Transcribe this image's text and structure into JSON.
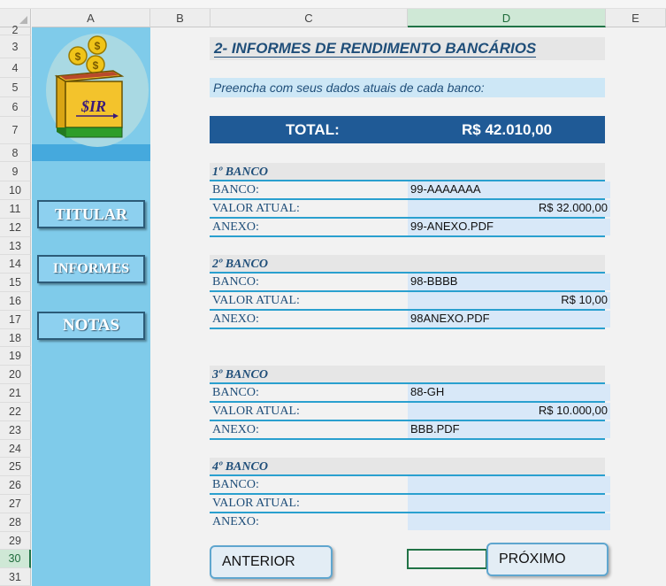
{
  "columns": [
    "A",
    "B",
    "C",
    "D",
    "E"
  ],
  "selected_column": "D",
  "rows": [
    "2",
    "3",
    "4",
    "5",
    "6",
    "7",
    "8",
    "9",
    "10",
    "11",
    "12",
    "13",
    "14",
    "15",
    "16",
    "17",
    "18",
    "19",
    "20",
    "21",
    "22",
    "23",
    "24",
    "25",
    "26",
    "27",
    "28",
    "29",
    "30",
    "31"
  ],
  "selected_row": "30",
  "logo": {
    "label": "$IR"
  },
  "sidebar": {
    "buttons": [
      "TITULAR",
      "INFORMES",
      "NOTAS"
    ]
  },
  "form": {
    "title": "2-  INFORMES DE RENDIMENTO BANCÁRIOS",
    "subtitle": "Preencha com seus dados atuais de cada banco:",
    "total_label": "TOTAL:",
    "total_value": "R$ 42.010,00",
    "banks": [
      {
        "heading": "1º BANCO",
        "banco_label": "BANCO:",
        "banco": "99-AAAAAAA",
        "valor_label": "VALOR ATUAL:",
        "valor": "R$ 32.000,00",
        "anexo_label": "ANEXO:",
        "anexo": "99-ANEXO.PDF"
      },
      {
        "heading": "2º BANCO",
        "banco_label": "BANCO:",
        "banco": "98-BBBB",
        "valor_label": "VALOR ATUAL:",
        "valor": "R$ 10,00",
        "anexo_label": "ANEXO:",
        "anexo": "98ANEXO.PDF"
      },
      {
        "heading": "3º BANCO",
        "banco_label": "BANCO:",
        "banco": "88-GH",
        "valor_label": "VALOR ATUAL:",
        "valor": "R$ 10.000,00",
        "anexo_label": "ANEXO:",
        "anexo": "BBB.PDF"
      },
      {
        "heading": "4º BANCO",
        "banco_label": "BANCO:",
        "banco": "",
        "valor_label": "VALOR ATUAL:",
        "valor": "",
        "anexo_label": "ANEXO:",
        "anexo": ""
      }
    ]
  },
  "nav": {
    "prev_label": "ANTERIOR",
    "next_label": "PRÓXIMO"
  },
  "colors": {
    "accent": "#1f4e79",
    "sidebar": "#7fcbea",
    "total_bar": "#1f5a96",
    "field_border": "#2aa0cf",
    "selection": "#217346"
  }
}
